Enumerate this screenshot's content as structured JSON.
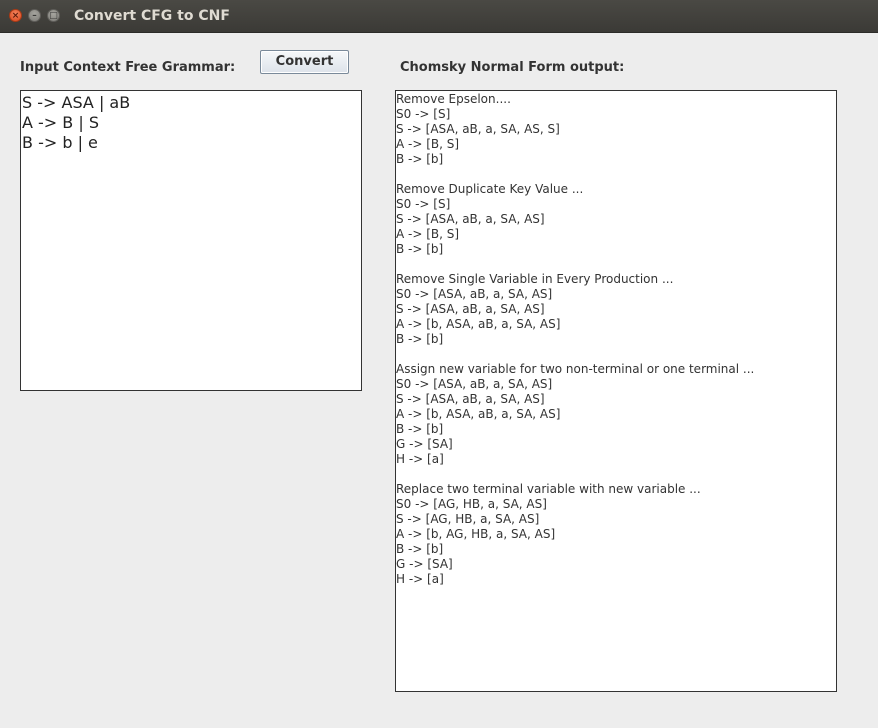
{
  "window": {
    "title": "Convert CFG to CNF"
  },
  "titlebar": {
    "close_glyph": "×",
    "minimize_glyph": "–",
    "maximize_glyph": "□"
  },
  "input": {
    "label": "Input Context Free Grammar:",
    "grammar": "S -> ASA | aB\nA -> B | S\nB -> b | e"
  },
  "toolbar": {
    "convert_label": "Convert"
  },
  "output": {
    "label": "Chomsky Normal Form output:",
    "text": "Remove Epselon....\nS0 -> [S]\nS -> [ASA, aB, a, SA, AS, S]\nA -> [B, S]\nB -> [b]\n\nRemove Duplicate Key Value ...\nS0 -> [S]\nS -> [ASA, aB, a, SA, AS]\nA -> [B, S]\nB -> [b]\n\nRemove Single Variable in Every Production ...\nS0 -> [ASA, aB, a, SA, AS]\nS -> [ASA, aB, a, SA, AS]\nA -> [b, ASA, aB, a, SA, AS]\nB -> [b]\n\nAssign new variable for two non-terminal or one terminal ...\nS0 -> [ASA, aB, a, SA, AS]\nS -> [ASA, aB, a, SA, AS]\nA -> [b, ASA, aB, a, SA, AS]\nB -> [b]\nG -> [SA]\nH -> [a]\n\nReplace two terminal variable with new variable ...\nS0 -> [AG, HB, a, SA, AS]\nS -> [AG, HB, a, SA, AS]\nA -> [b, AG, HB, a, SA, AS]\nB -> [b]\nG -> [SA]\nH -> [a]"
  }
}
